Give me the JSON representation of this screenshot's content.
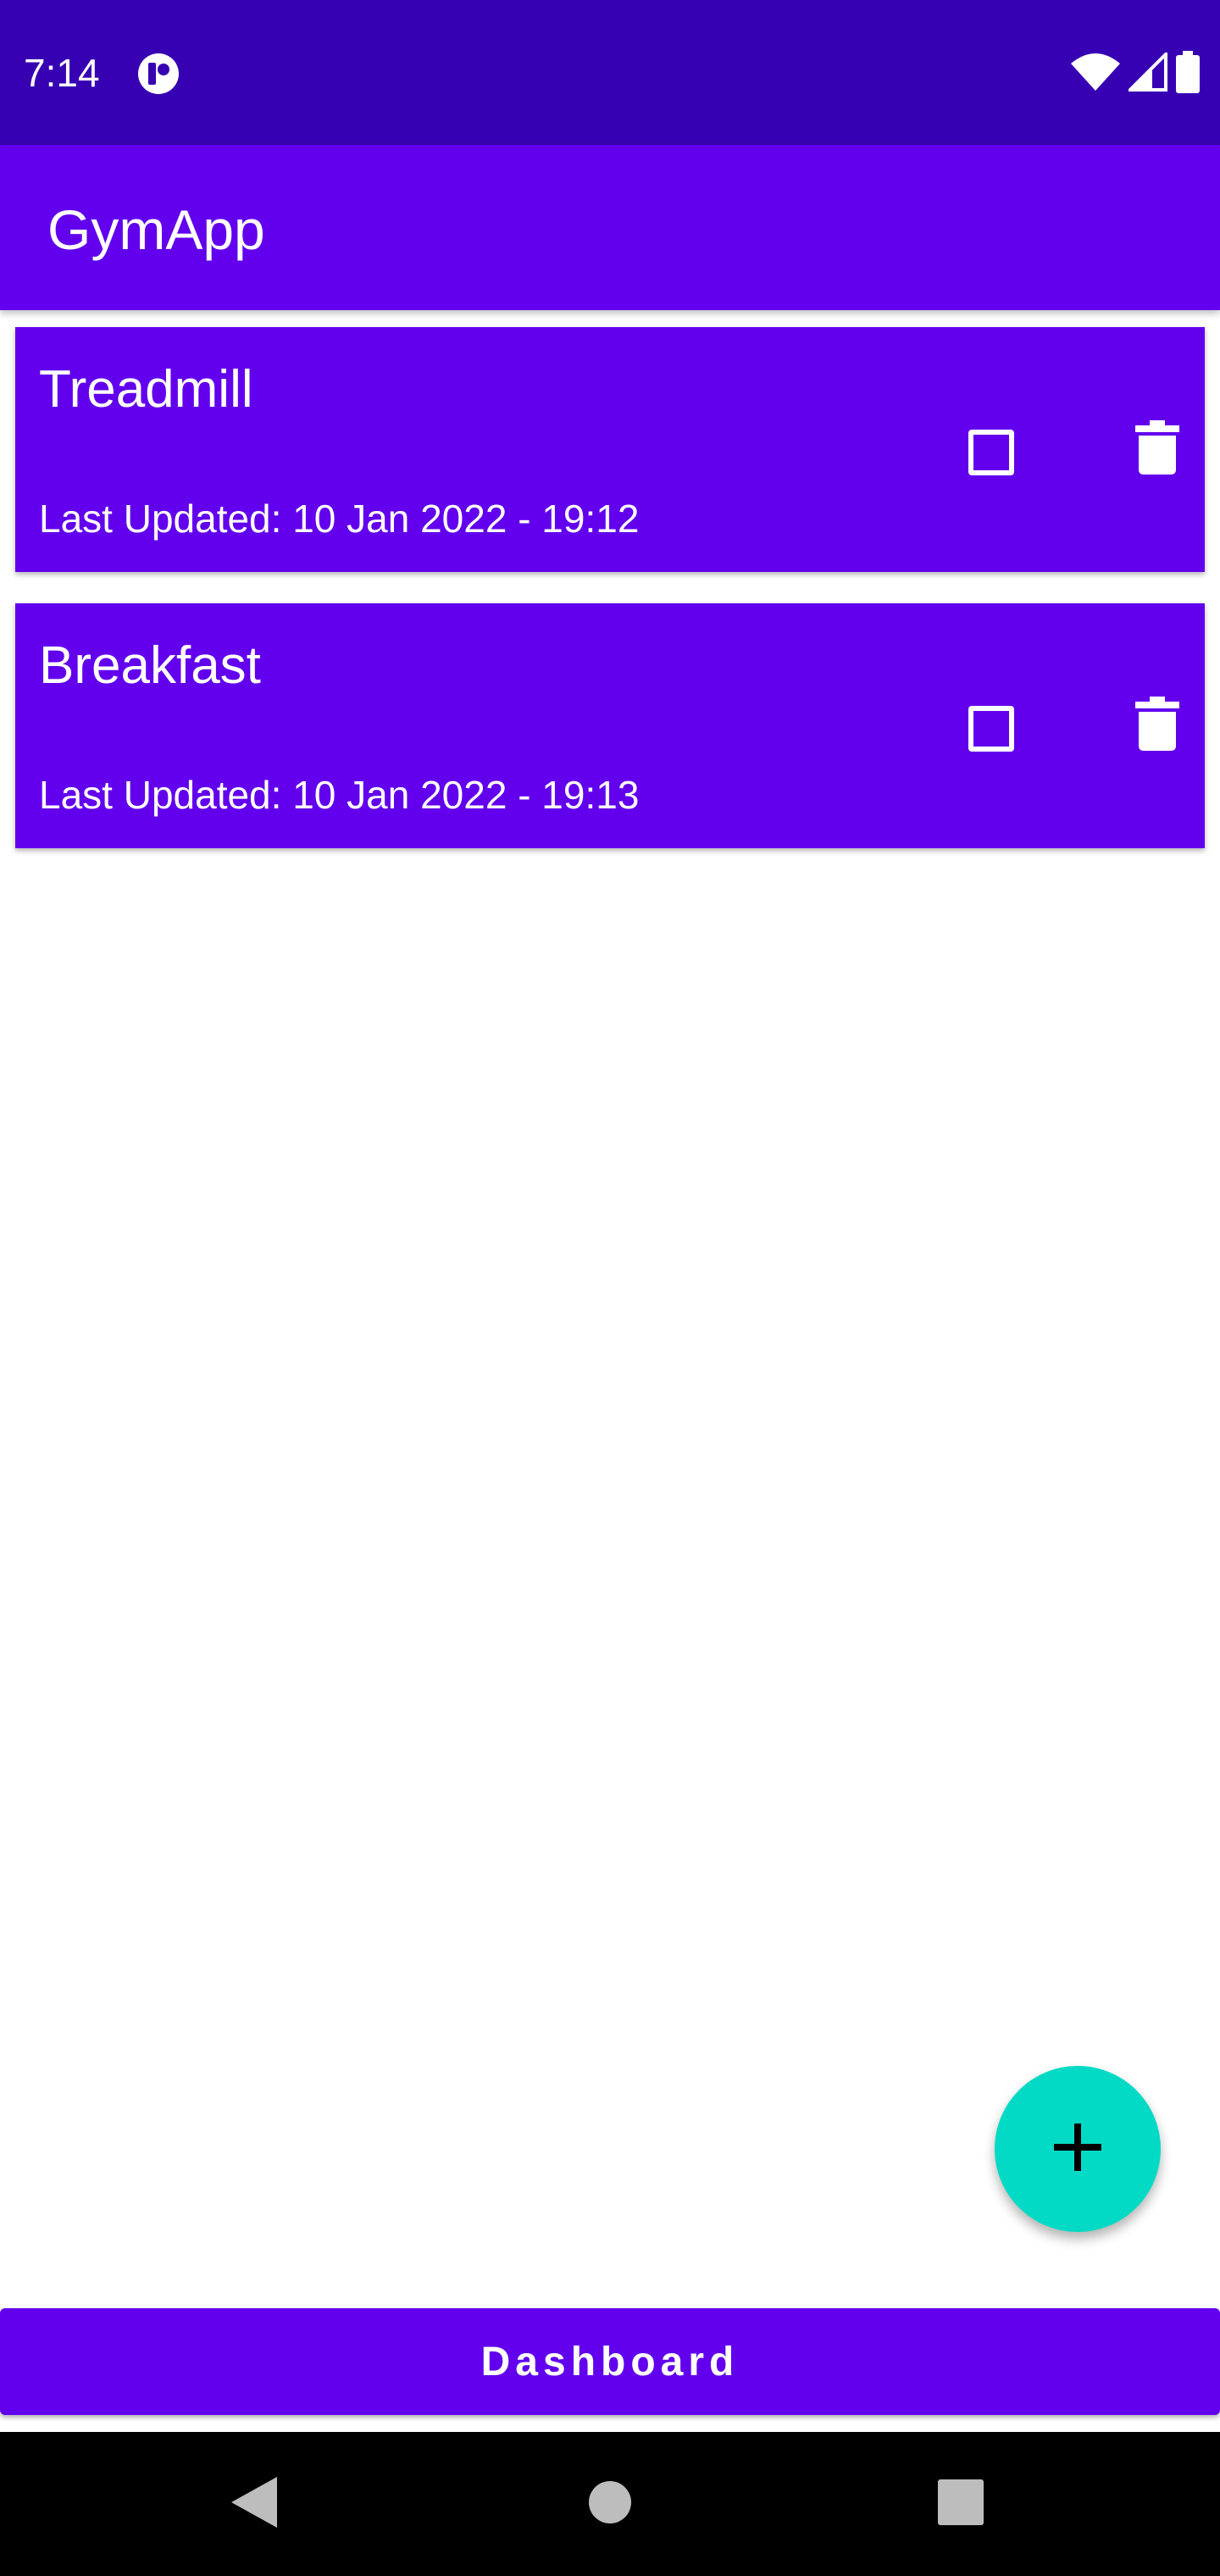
{
  "status_bar": {
    "time": "7:14",
    "app_icon": "data-saver-icon",
    "icons": [
      "wifi-icon",
      "cellular-signal-icon",
      "battery-icon"
    ]
  },
  "app_bar": {
    "title": "GymApp"
  },
  "items": [
    {
      "title": "Treadmill",
      "subtitle": "Last Updated: 10 Jan 2022 - 19:12",
      "checked": false
    },
    {
      "title": "Breakfast",
      "subtitle": "Last Updated: 10 Jan 2022 - 19:13",
      "checked": false
    }
  ],
  "fab": {
    "icon": "plus-icon"
  },
  "dashboard": {
    "label": "Dashboard"
  },
  "nav_bar": {
    "icons": [
      "back-icon",
      "home-icon",
      "recents-icon"
    ]
  },
  "colors": {
    "status_bar": "#3700b3",
    "primary": "#6200ee",
    "accent": "#03dac5",
    "nav_bar": "#000000"
  }
}
